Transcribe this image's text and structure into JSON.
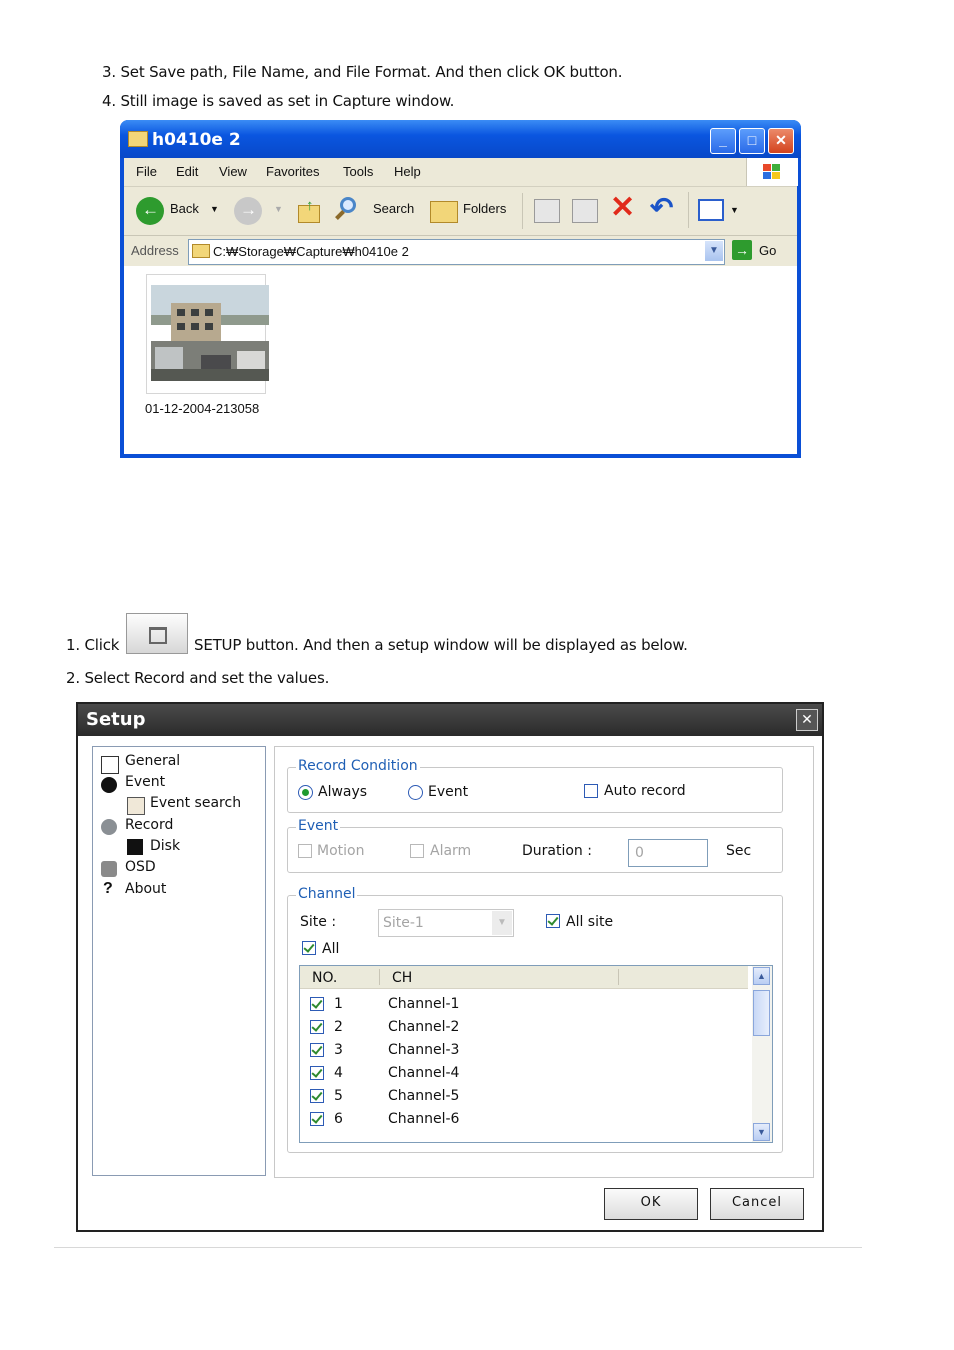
{
  "doc": {
    "step3": "3. Set Save path, File Name, and File Format. And then click OK button.",
    "step4": "4. Still image is saved as set in Capture window.",
    "click_prefix": "1. Click",
    "click_suffix": "SETUP button. And then a setup window will be displayed as below.",
    "step2": "2. Select Record and set the values."
  },
  "explorer": {
    "title": "h0410e 2",
    "menu": [
      "File",
      "Edit",
      "View",
      "Favorites",
      "Tools",
      "Help"
    ],
    "toolbar": {
      "back": "Back",
      "search": "Search",
      "folders": "Folders"
    },
    "address_label": "Address",
    "address_value": "C:₩Storage₩Capture₩h0410e 2",
    "go": "Go",
    "file_name": "01-12-2004-213058"
  },
  "setup": {
    "title": "Setup",
    "tree": {
      "general": "General",
      "event": "Event",
      "event_search": "Event search",
      "record": "Record",
      "disk": "Disk",
      "osd": "OSD",
      "about": "About"
    },
    "record_condition": {
      "legend": "Record Condition",
      "always": "Always",
      "always_selected": true,
      "event": "Event",
      "auto_record": "Auto record",
      "auto_record_checked": false
    },
    "event_group": {
      "legend": "Event",
      "motion": "Motion",
      "alarm": "Alarm",
      "duration_label": "Duration :",
      "duration_value": "0",
      "sec": "Sec"
    },
    "channel": {
      "legend": "Channel",
      "site_label": "Site :",
      "site_value": "Site-1",
      "all_site": "All site",
      "all": "All",
      "col_no": "NO.",
      "col_ch": "CH",
      "rows": [
        {
          "no": "1",
          "ch": "Channel-1"
        },
        {
          "no": "2",
          "ch": "Channel-2"
        },
        {
          "no": "3",
          "ch": "Channel-3"
        },
        {
          "no": "4",
          "ch": "Channel-4"
        },
        {
          "no": "5",
          "ch": "Channel-5"
        },
        {
          "no": "6",
          "ch": "Channel-6"
        }
      ]
    },
    "ok": "OK",
    "cancel": "Cancel"
  },
  "colors": {
    "xp_blue": "#0a4fd6",
    "legend_blue": "#1f5fb5",
    "setup_title": "#333333"
  }
}
